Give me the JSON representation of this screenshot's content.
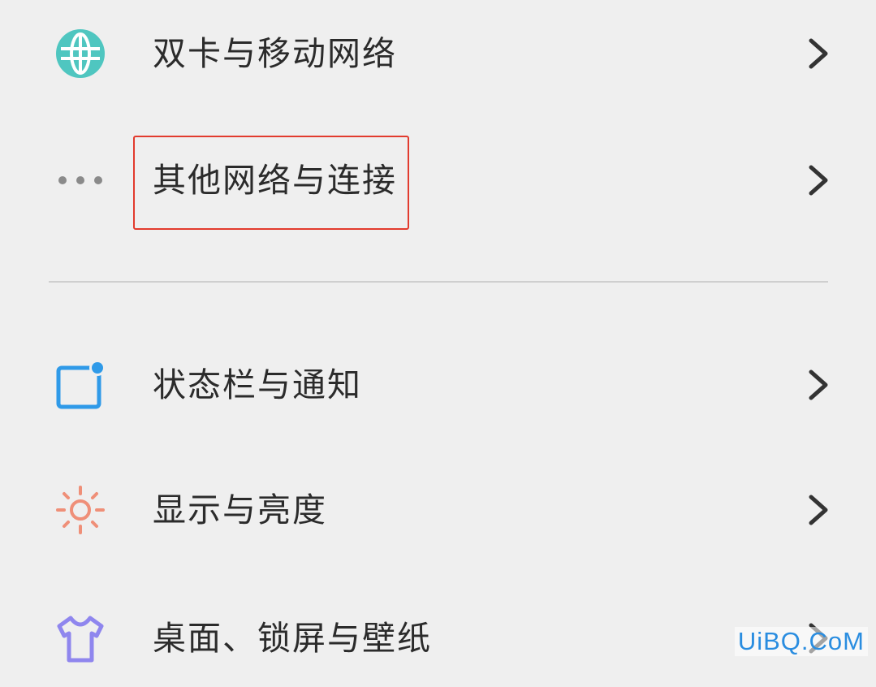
{
  "settings": {
    "items": [
      {
        "label": "双卡与移动网络",
        "icon": "globe-icon"
      },
      {
        "label": "其他网络与连接",
        "icon": "more-dots-icon"
      },
      {
        "label": "状态栏与通知",
        "icon": "notification-square-icon"
      },
      {
        "label": "显示与亮度",
        "icon": "sun-icon"
      },
      {
        "label": "桌面、锁屏与壁纸",
        "icon": "tshirt-icon"
      }
    ]
  },
  "watermark": {
    "text": "UiBQ.CoM"
  },
  "colors": {
    "globe": "#4fc6c0",
    "dots": "#8a8a8a",
    "notification": "#2f9ae8",
    "sun": "#ef8f78",
    "tshirt": "#8f86ee",
    "highlight": "#e23b2e",
    "watermark": "#2a8de0"
  }
}
